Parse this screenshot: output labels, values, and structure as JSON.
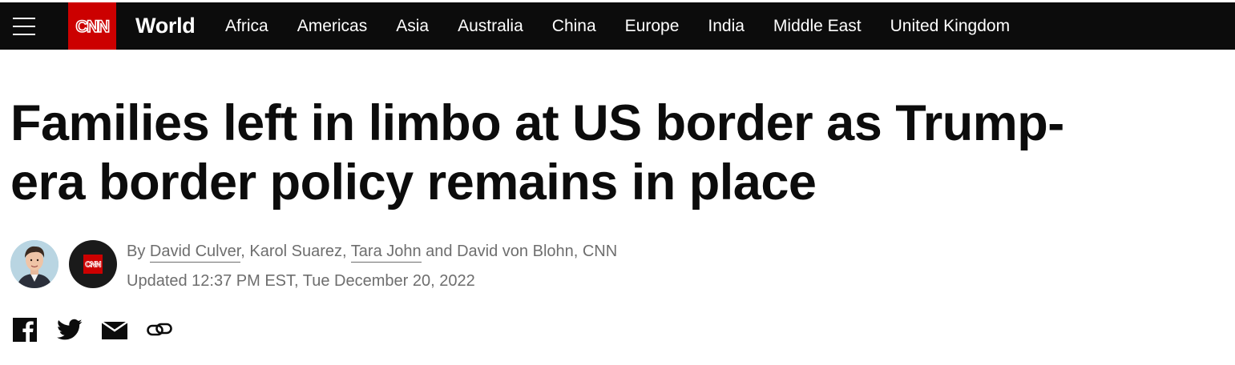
{
  "header": {
    "menu_icon": "hamburger-menu-icon",
    "logo_text": "CNN",
    "section_title": "World",
    "nav_items": [
      {
        "label": "Africa"
      },
      {
        "label": "Americas"
      },
      {
        "label": "Asia"
      },
      {
        "label": "Australia"
      },
      {
        "label": "China"
      },
      {
        "label": "Europe"
      },
      {
        "label": "India"
      },
      {
        "label": "Middle East"
      },
      {
        "label": "United Kingdom"
      }
    ],
    "colors": {
      "bar": "#0c0c0c",
      "brand": "#cc0000",
      "text": "#ffffff"
    }
  },
  "article": {
    "headline_line1": "Families left in limbo at US border as Trump-",
    "headline_line2": "era border policy remains in place",
    "byline": {
      "prefix": "By",
      "author1": "David Culver",
      "sep1": ", Karol Suarez, ",
      "author2": "Tara John",
      "suffix": " and David von Blohn, CNN"
    },
    "updated": "Updated 12:37 PM EST, Tue December 20, 2022",
    "avatars": [
      "author-photo",
      "cnn-logo-avatar"
    ]
  },
  "share": {
    "icons": [
      "facebook-icon",
      "twitter-icon",
      "email-icon",
      "link-icon"
    ]
  }
}
